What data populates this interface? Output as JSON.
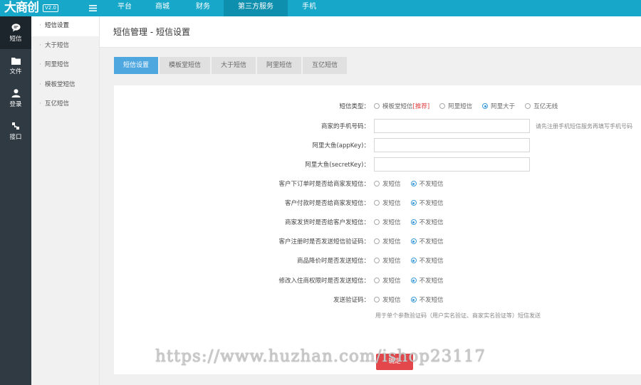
{
  "app": {
    "logo": "大商创",
    "version": "V2.0",
    "menu_icon": "menu-icon"
  },
  "top_nav": [
    {
      "label": "平台",
      "active": false
    },
    {
      "label": "商城",
      "active": false
    },
    {
      "label": "财务",
      "active": false
    },
    {
      "label": "第三方服务",
      "active": true
    },
    {
      "label": "手机",
      "active": false
    }
  ],
  "sidebar": [
    {
      "label": "短信",
      "icon": "chat-icon",
      "active": true
    },
    {
      "label": "文件",
      "icon": "folder-icon",
      "active": false
    },
    {
      "label": "登录",
      "icon": "user-icon",
      "active": false
    },
    {
      "label": "接口",
      "icon": "plug-icon",
      "active": false
    }
  ],
  "submenu": [
    {
      "label": "短信设置",
      "active": true
    },
    {
      "label": "大于短信",
      "active": false
    },
    {
      "label": "阿里短信",
      "active": false
    },
    {
      "label": "模板堂短信",
      "active": false
    },
    {
      "label": "互亿短信",
      "active": false
    }
  ],
  "page": {
    "title": "短信管理 - 短信设置"
  },
  "tabs": [
    {
      "label": "短信设置",
      "active": true
    },
    {
      "label": "模板堂短信",
      "active": false
    },
    {
      "label": "大于短信",
      "active": false
    },
    {
      "label": "阿里短信",
      "active": false
    },
    {
      "label": "互亿短信",
      "active": false
    }
  ],
  "form": {
    "sms_type": {
      "label": "短信类型：",
      "options": [
        {
          "label": "模板堂短信",
          "tag": "[推荐]",
          "checked": false
        },
        {
          "label": "阿里短信",
          "tag": "",
          "checked": false
        },
        {
          "label": "阿里大于",
          "tag": "",
          "checked": true
        },
        {
          "label": "互亿无线",
          "tag": "",
          "checked": false
        }
      ]
    },
    "merchant_phone": {
      "label": "商家的手机号码：",
      "value": "",
      "hint": "请先注册手机短信服务再填写手机号码"
    },
    "app_key": {
      "label": "阿里大鱼(appKey)：",
      "value": ""
    },
    "secret_key": {
      "label": "阿里大鱼(secretKey)：",
      "value": ""
    },
    "switches": [
      {
        "label": "客户下订单时是否给商家发短信：",
        "on_label": "发短信",
        "off_label": "不发短信",
        "value": "off"
      },
      {
        "label": "客户付款时是否给商家发短信：",
        "on_label": "发短信",
        "off_label": "不发短信",
        "value": "off"
      },
      {
        "label": "商家发货时是否给客户发短信：",
        "on_label": "发短信",
        "off_label": "不发短信",
        "value": "off"
      },
      {
        "label": "客户注册时是否发送短信验证码：",
        "on_label": "发短信",
        "off_label": "不发短信",
        "value": "off"
      },
      {
        "label": "商品降价时是否发送短信：",
        "on_label": "发短信",
        "off_label": "不发短信",
        "value": "off"
      },
      {
        "label": "修改入住商权限时是否发送短信：",
        "on_label": "发短信",
        "off_label": "不发短信",
        "value": "off"
      },
      {
        "label": "发送验证码：",
        "on_label": "发短信",
        "off_label": "不发短信",
        "value": "off"
      }
    ],
    "verify_hint": "用于单个参数验证码（用户实名验证、商家实名验证等）短信发送",
    "submit_label": "确定"
  },
  "watermark": "https://www.huzhan.com/ishop23117",
  "colors": {
    "topbar": "#17a7c9",
    "sidebar": "#2f3a42",
    "tab_active": "#4fa7e0",
    "submit": "#e4474b",
    "recommend_tag": "#e04040"
  }
}
